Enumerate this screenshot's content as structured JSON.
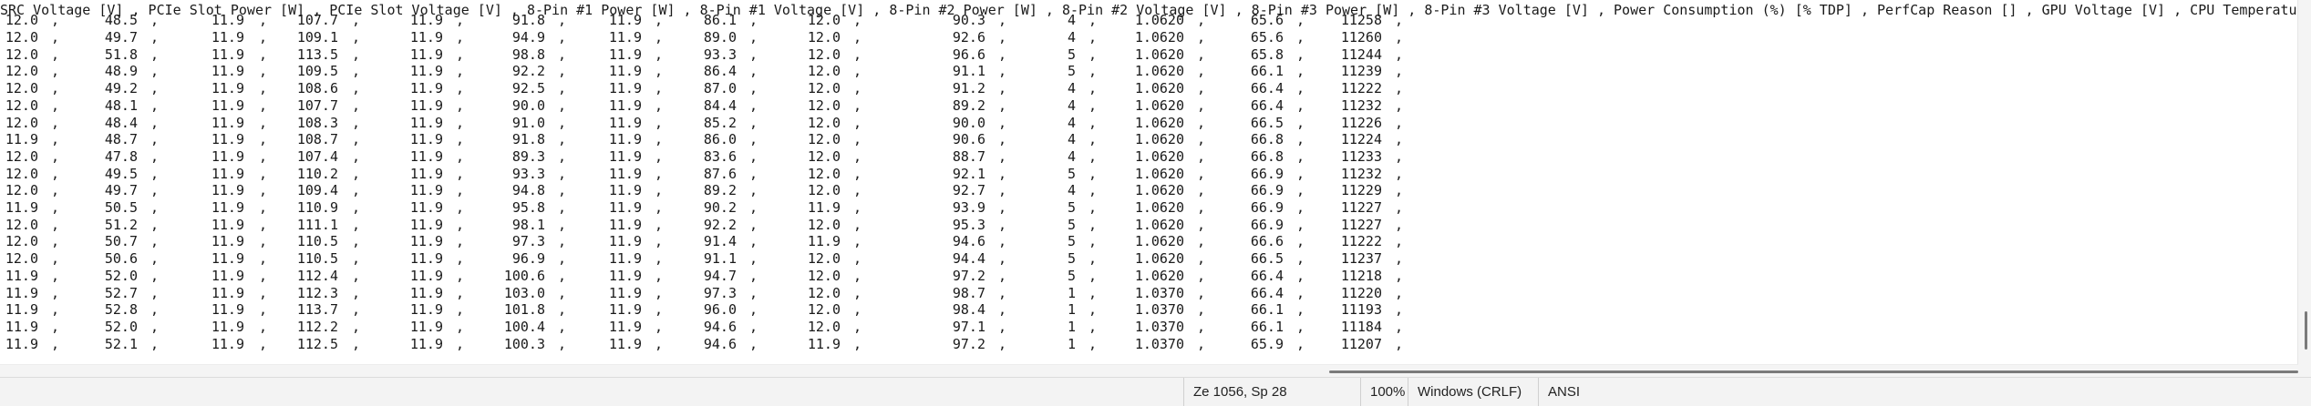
{
  "editor": {
    "header_line": "SRC Voltage [V] , PCIe Slot Power [W] , PCIe Slot Voltage [V] , 8-Pin #1 Power [W] , 8-Pin #1 Voltage [V] , 8-Pin #2 Power [W] , 8-Pin #2 Voltage [V] , 8-Pin #3 Power [W] , 8-Pin #3 Voltage [V] , Power Consumption (%) [% TDP] , PerfCap Reason [] , GPU Voltage [V] , CPU Temperature [°C] , System Memory Used [MB] ,",
    "separator": ",",
    "rows": [
      [
        "12.0",
        "48.5",
        "11.9",
        "107.7",
        "11.9",
        "91.8",
        "11.9",
        "86.1",
        "12.0",
        "90.3",
        "4",
        "1.0620",
        "65.6",
        "11258"
      ],
      [
        "12.0",
        "49.7",
        "11.9",
        "109.1",
        "11.9",
        "94.9",
        "11.9",
        "89.0",
        "12.0",
        "92.6",
        "4",
        "1.0620",
        "65.6",
        "11260"
      ],
      [
        "12.0",
        "51.8",
        "11.9",
        "113.5",
        "11.9",
        "98.8",
        "11.9",
        "93.3",
        "12.0",
        "96.6",
        "5",
        "1.0620",
        "65.8",
        "11244"
      ],
      [
        "12.0",
        "48.9",
        "11.9",
        "109.5",
        "11.9",
        "92.2",
        "11.9",
        "86.4",
        "12.0",
        "91.1",
        "5",
        "1.0620",
        "66.1",
        "11239"
      ],
      [
        "12.0",
        "49.2",
        "11.9",
        "108.6",
        "11.9",
        "92.5",
        "11.9",
        "87.0",
        "12.0",
        "91.2",
        "4",
        "1.0620",
        "66.4",
        "11222"
      ],
      [
        "12.0",
        "48.1",
        "11.9",
        "107.7",
        "11.9",
        "90.0",
        "11.9",
        "84.4",
        "12.0",
        "89.2",
        "4",
        "1.0620",
        "66.4",
        "11232"
      ],
      [
        "12.0",
        "48.4",
        "11.9",
        "108.3",
        "11.9",
        "91.0",
        "11.9",
        "85.2",
        "12.0",
        "90.0",
        "4",
        "1.0620",
        "66.5",
        "11226"
      ],
      [
        "11.9",
        "48.7",
        "11.9",
        "108.7",
        "11.9",
        "91.8",
        "11.9",
        "86.0",
        "12.0",
        "90.6",
        "4",
        "1.0620",
        "66.8",
        "11224"
      ],
      [
        "12.0",
        "47.8",
        "11.9",
        "107.4",
        "11.9",
        "89.3",
        "11.9",
        "83.6",
        "12.0",
        "88.7",
        "4",
        "1.0620",
        "66.8",
        "11233"
      ],
      [
        "12.0",
        "49.5",
        "11.9",
        "110.2",
        "11.9",
        "93.3",
        "11.9",
        "87.6",
        "12.0",
        "92.1",
        "5",
        "1.0620",
        "66.9",
        "11232"
      ],
      [
        "12.0",
        "49.7",
        "11.9",
        "109.4",
        "11.9",
        "94.8",
        "11.9",
        "89.2",
        "12.0",
        "92.7",
        "4",
        "1.0620",
        "66.9",
        "11229"
      ],
      [
        "11.9",
        "50.5",
        "11.9",
        "110.9",
        "11.9",
        "95.8",
        "11.9",
        "90.2",
        "11.9",
        "93.9",
        "5",
        "1.0620",
        "66.9",
        "11227"
      ],
      [
        "12.0",
        "51.2",
        "11.9",
        "111.1",
        "11.9",
        "98.1",
        "11.9",
        "92.2",
        "12.0",
        "95.3",
        "5",
        "1.0620",
        "66.9",
        "11227"
      ],
      [
        "12.0",
        "50.7",
        "11.9",
        "110.5",
        "11.9",
        "97.3",
        "11.9",
        "91.4",
        "11.9",
        "94.6",
        "5",
        "1.0620",
        "66.6",
        "11222"
      ],
      [
        "12.0",
        "50.6",
        "11.9",
        "110.5",
        "11.9",
        "96.9",
        "11.9",
        "91.1",
        "12.0",
        "94.4",
        "5",
        "1.0620",
        "66.5",
        "11237"
      ],
      [
        "11.9",
        "52.0",
        "11.9",
        "112.4",
        "11.9",
        "100.6",
        "11.9",
        "94.7",
        "12.0",
        "97.2",
        "5",
        "1.0620",
        "66.4",
        "11218"
      ],
      [
        "11.9",
        "52.7",
        "11.9",
        "112.3",
        "11.9",
        "103.0",
        "11.9",
        "97.3",
        "12.0",
        "98.7",
        "1",
        "1.0370",
        "66.4",
        "11220"
      ],
      [
        "11.9",
        "52.8",
        "11.9",
        "113.7",
        "11.9",
        "101.8",
        "11.9",
        "96.0",
        "12.0",
        "98.4",
        "1",
        "1.0370",
        "66.1",
        "11193"
      ],
      [
        "11.9",
        "52.0",
        "11.9",
        "112.2",
        "11.9",
        "100.4",
        "11.9",
        "94.6",
        "12.0",
        "97.1",
        "1",
        "1.0370",
        "66.1",
        "11184"
      ],
      [
        "11.9",
        "52.1",
        "11.9",
        "112.5",
        "11.9",
        "100.3",
        "11.9",
        "94.6",
        "11.9",
        "97.2",
        "1",
        "1.0370",
        "65.9",
        "11207"
      ]
    ]
  },
  "statusbar": {
    "position": "Ze 1056, Sp 28",
    "zoom": "100%",
    "line_ending": "Windows (CRLF)",
    "encoding": "ANSI"
  }
}
